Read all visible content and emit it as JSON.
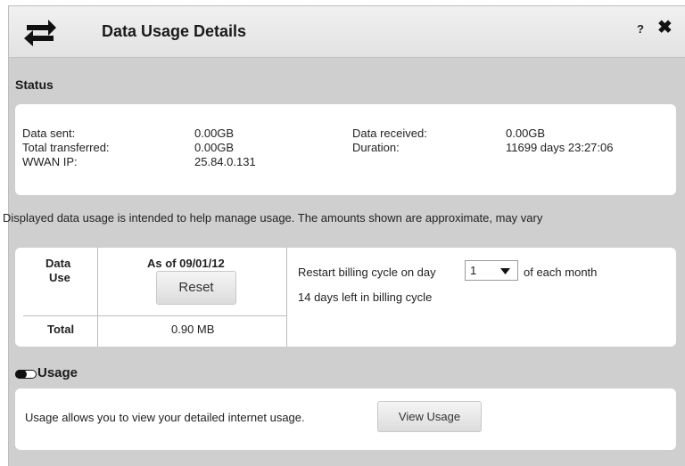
{
  "dialog": {
    "title": "Data Usage Details",
    "help_label": "?",
    "close_label": "✖"
  },
  "status": {
    "heading": "Status",
    "data_sent_label": "Data sent:",
    "data_sent_value": "0.00GB",
    "total_transferred_label": "Total transferred:",
    "total_transferred_value": "0.00GB",
    "wwan_ip_label": "WWAN IP:",
    "wwan_ip_value": "25.84.0.131",
    "data_received_label": "Data received:",
    "data_received_value": "0.00GB",
    "duration_label": "Duration:",
    "duration_value": "11699 days 23:27:06"
  },
  "notice": "Displayed data usage is intended to help manage usage. The amounts shown are approximate, may vary",
  "data_use": {
    "row_header_line1": "Data",
    "row_header_line2": "Use",
    "as_of_label": "As of 09/01/12",
    "reset_label": "Reset",
    "total_label": "Total",
    "total_value": "0.90 MB",
    "restart_prefix": "Restart billing cycle on day",
    "restart_day": "1",
    "restart_suffix": "of each month",
    "days_left": "14 days left in billing cycle"
  },
  "usage": {
    "heading": "Usage",
    "description": "Usage allows you to view your detailed internet usage.",
    "view_button_label": "View Usage"
  }
}
